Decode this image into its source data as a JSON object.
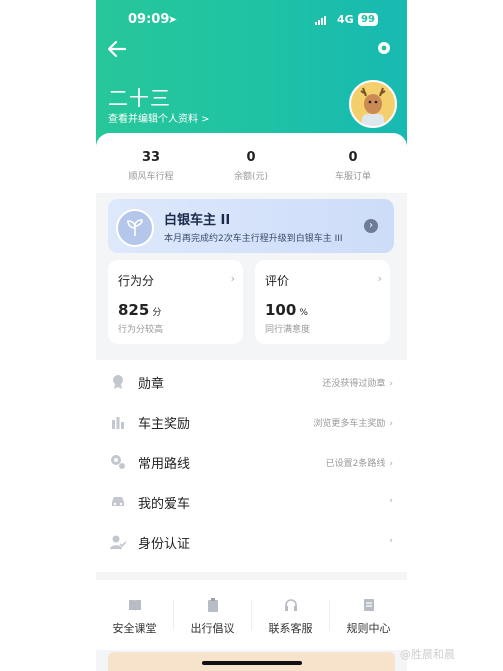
{
  "status_bar": {
    "time": "09:09",
    "network": "4G",
    "battery": "99"
  },
  "profile": {
    "name": "二十三",
    "edit_link": "查看并编辑个人资料 >"
  },
  "stats": [
    {
      "value": "33",
      "label": "顺风车行程"
    },
    {
      "value": "0",
      "label": "余额(元)"
    },
    {
      "value": "0",
      "label": "车服订单"
    }
  ],
  "level": {
    "title": "白银车主 II",
    "subtitle": "本月再完成约2次车主行程升级到白银车主 III"
  },
  "scores": [
    {
      "title": "行为分",
      "value": "825",
      "unit": "分",
      "desc": "行为分较高"
    },
    {
      "title": "评价",
      "value": "100",
      "unit": "%",
      "desc": "同行满意度"
    }
  ],
  "menu": [
    {
      "icon": "medal-icon",
      "label": "勋章",
      "hint": "还没获得过勋章"
    },
    {
      "icon": "reward-icon",
      "label": "车主奖励",
      "hint": "浏览更多车主奖励"
    },
    {
      "icon": "route-icon",
      "label": "常用路线",
      "hint": "已设置2条路线"
    },
    {
      "icon": "car-icon",
      "label": "我的爱车",
      "hint": ""
    },
    {
      "icon": "id-icon",
      "label": "身份认证",
      "hint": ""
    }
  ],
  "bottom_tabs": [
    {
      "icon": "book-icon",
      "label": "安全课堂"
    },
    {
      "icon": "clipboard-icon",
      "label": "出行倡议"
    },
    {
      "icon": "headset-icon",
      "label": "联系客服"
    },
    {
      "icon": "document-icon",
      "label": "规则中心"
    }
  ],
  "watermark": "@胜晨和晨",
  "colors": {
    "header_start": "#27c79a",
    "header_end": "#17b9b3",
    "level_bg": "#dde8fb"
  }
}
